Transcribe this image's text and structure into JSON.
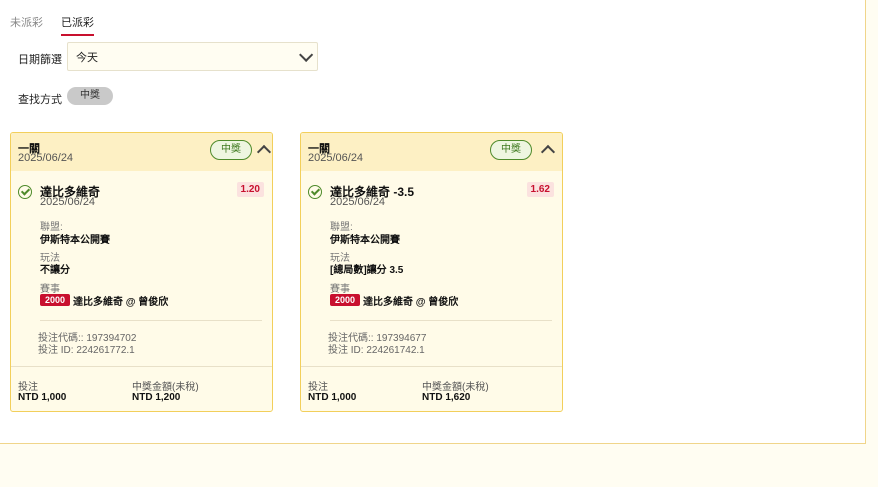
{
  "tabs": [
    {
      "label": "未派彩",
      "active": false
    },
    {
      "label": "已派彩",
      "active": true
    }
  ],
  "filters": {
    "date_label": "日期篩選",
    "date_value": "今天",
    "search_label": "查找方式",
    "search_pill": "中獎"
  },
  "cards": [
    {
      "title": "一關",
      "date": "2025/06/24",
      "badge": "中獎",
      "selection": "達比多維奇",
      "selection_date": "2025/06/24",
      "odds": "1.20",
      "league_label": "聯盟:",
      "league": "伊斯特本公開賽",
      "market_label": "玩法",
      "market": "不讓分",
      "event_label": "賽事",
      "event_no": "2000",
      "event": "達比多維奇 @ 曾俊欣",
      "bet_code": "投注代碼:: 197394702",
      "bet_id": "投注 ID: 224261772.1",
      "stake_label": "投注",
      "stake": "NTD 1,000",
      "win_label": "中獎金額(未稅)",
      "win": "NTD 1,200"
    },
    {
      "title": "一關",
      "date": "2025/06/24",
      "badge": "中獎",
      "selection": "達比多維奇 -3.5",
      "selection_date": "2025/06/24",
      "odds": "1.62",
      "league_label": "聯盟:",
      "league": "伊斯特本公開賽",
      "market_label": "玩法",
      "market": "[總局數]讓分 3.5",
      "event_label": "賽事",
      "event_no": "2000",
      "event": "達比多維奇 @ 曾俊欣",
      "bet_code": "投注代碼:: 197394677",
      "bet_id": "投注 ID: 224261742.1",
      "stake_label": "投注",
      "stake": "NTD 1,000",
      "win_label": "中獎金額(未稅)",
      "win": "NTD 1,620"
    }
  ],
  "colors": {
    "accent_red": "#c8102e",
    "win_green": "#4e8a2a",
    "card_border": "#f2cf5b"
  }
}
